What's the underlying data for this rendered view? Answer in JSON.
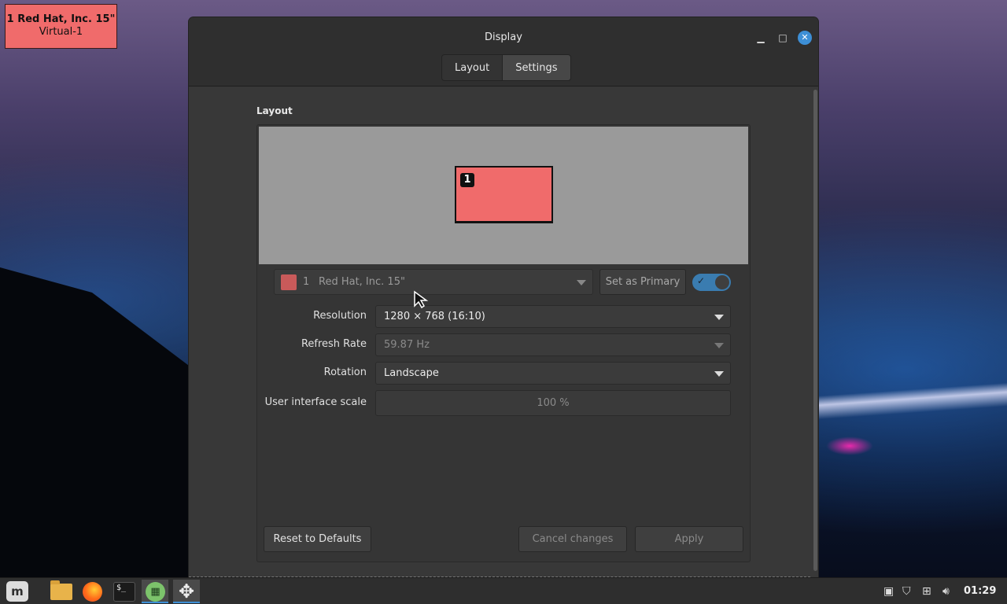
{
  "osd": {
    "line1": "1  Red Hat, Inc. 15\"",
    "line2": "Virtual-1"
  },
  "window": {
    "title": "Display",
    "tabs": [
      {
        "label": "Layout",
        "active": false
      },
      {
        "label": "Settings",
        "active": true
      }
    ]
  },
  "layout": {
    "section_title": "Layout",
    "monitor_number": "1",
    "monitor_color": "#f06b6b"
  },
  "monitor_select": {
    "index": "1",
    "name": "Red Hat, Inc. 15\""
  },
  "set_primary_label": "Set as Primary",
  "monitor_enabled": true,
  "settings": {
    "resolution": {
      "label": "Resolution",
      "value": "1280 × 768 (16:10)"
    },
    "refresh_rate": {
      "label": "Refresh Rate",
      "value": "59.87 Hz"
    },
    "rotation": {
      "label": "Rotation",
      "value": "Landscape"
    },
    "ui_scale": {
      "label": "User interface scale",
      "value": "100 %"
    }
  },
  "buttons": {
    "reset": "Reset to Defaults",
    "cancel": "Cancel changes",
    "apply": "Apply"
  },
  "taskbar": {
    "apps": [
      "mint-menu-icon",
      "files-icon",
      "firefox-icon",
      "terminal-icon",
      "calculator-icon",
      "display-settings-icon"
    ],
    "clock": "01:29"
  },
  "colors": {
    "accent": "#3d8fd6",
    "toggle_on": "#3a7cb0"
  }
}
